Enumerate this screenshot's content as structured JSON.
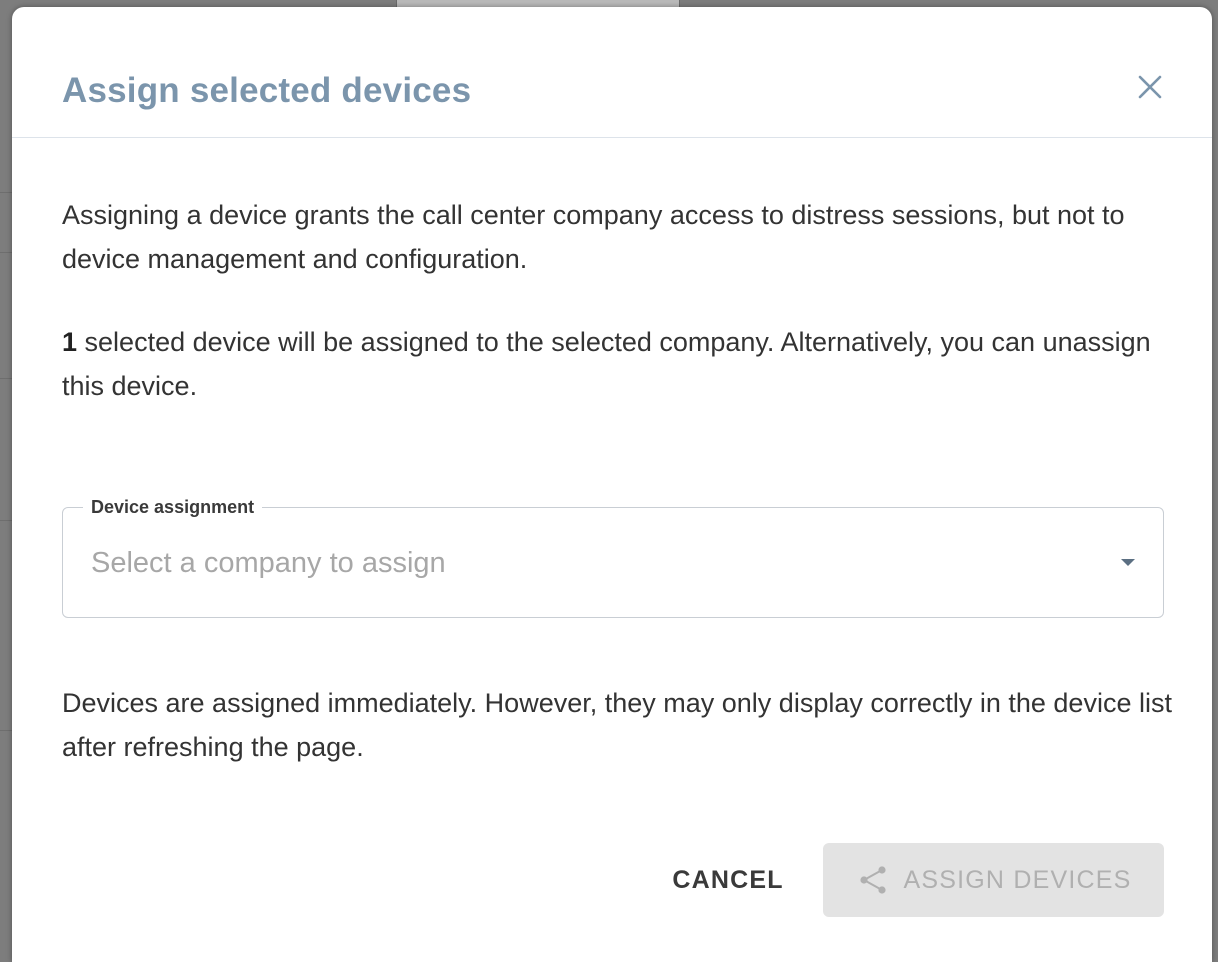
{
  "dialog": {
    "title": "Assign selected devices",
    "close_icon": "close-icon",
    "intro": "Assigning a device grants the call center company access to distress sessions, but not to device management and configuration.",
    "selection": {
      "count": "1",
      "text": " selected device will be assigned to the selected company. Alternatively, you can unassign this device."
    },
    "field": {
      "label": "Device assignment",
      "placeholder": "Select a company to assign",
      "value": "",
      "arrow_icon": "caret-down-icon"
    },
    "note": "Devices are assigned immediately. However, they may only display correctly in the device list after refreshing the page.",
    "actions": {
      "cancel_label": "CANCEL",
      "assign_label": "ASSIGN DEVICES",
      "assign_icon": "share-icon",
      "assign_disabled": true
    }
  },
  "colors": {
    "title": "#7b95ac",
    "text": "#333333",
    "placeholder": "#a7a7a7",
    "disabled_bg": "#e3e3e3",
    "disabled_text": "#b0b0b0",
    "overlay": "#7d7d7d"
  }
}
